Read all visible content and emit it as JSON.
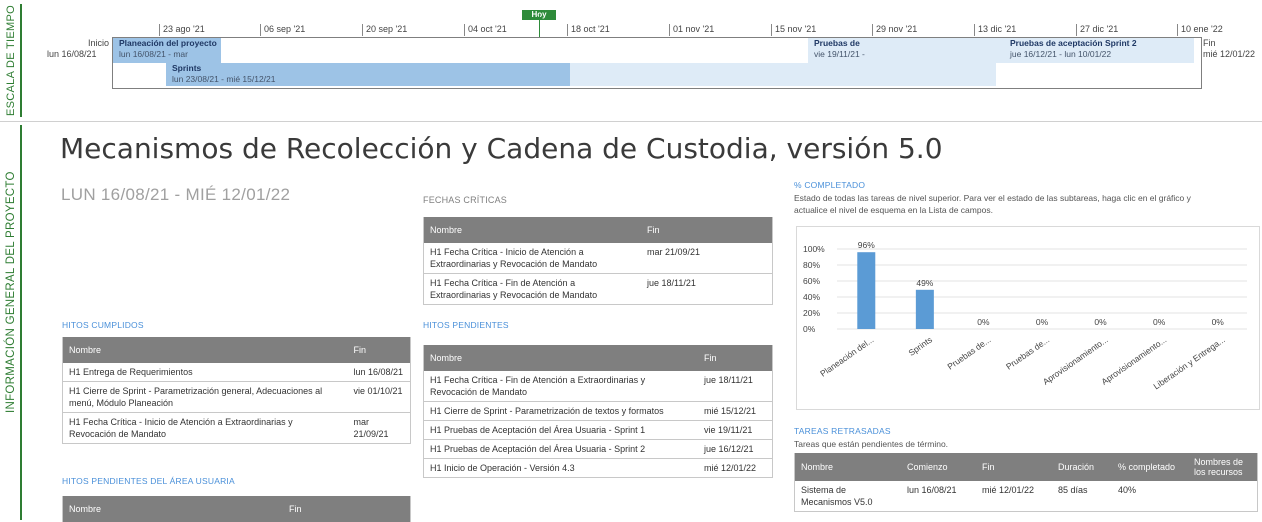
{
  "sidebar": {
    "timeline_label": "ESCALA DE TIEMPO",
    "project_label": "INFORMACIÓN GENERAL DEL PROYECTO"
  },
  "timeline": {
    "today_label": "Hoy",
    "start_label": "Inicio",
    "start_date": "lun 16/08/21",
    "end_label": "Fin",
    "end_date": "mié 12/01/22",
    "ticks": [
      "23 ago '21",
      "06 sep '21",
      "20 sep '21",
      "04 oct '21",
      "18 oct '21",
      "01 nov '21",
      "15 nov '21",
      "29 nov '21",
      "13 dic '21",
      "27 dic '21",
      "10 ene '22"
    ],
    "tasks": [
      {
        "name": "Planeación del proyecto",
        "dates": "lun 16/08/21 - mar"
      },
      {
        "name": "Sprints",
        "dates": "lun 23/08/21 - mié 15/12/21"
      },
      {
        "name": "Pruebas de",
        "dates": "vie 19/11/21 -"
      },
      {
        "name": "Pruebas de aceptación Sprint  2",
        "dates": "jue 16/12/21 - lun 10/01/22"
      }
    ],
    "colors": {
      "bar_dark": "#9dc3e6",
      "bar_light": "#deebf7",
      "today": "#2e8b3a"
    }
  },
  "project": {
    "title": "Mecanismos de Recolección y Cadena de Custodia, versión 5.0",
    "date_range": "LUN 16/08/21 -  MIÉ 12/01/22"
  },
  "hitos_cumplidos": {
    "title": "HITOS CUMPLIDOS",
    "headers": [
      "Nombre",
      "Fin"
    ],
    "rows": [
      [
        "H1 Entrega de Requerimientos",
        "lun 16/08/21"
      ],
      [
        "H1 Cierre de Sprint - Parametrización general, Adecuaciones al menú, Módulo Planeación",
        "vie 01/10/21"
      ],
      [
        "H1 Fecha Crítica - Inicio de Atención a Extraordinarias y Revocación de Mandato",
        "mar 21/09/21"
      ]
    ]
  },
  "hitos_usuaria": {
    "title": "HITOS PENDIENTES DEL ÁREA USUARIA",
    "headers": [
      "Nombre",
      "Fin"
    ]
  },
  "fechas_criticas": {
    "title": "FECHAS CRÍTICAS",
    "headers": [
      "Nombre",
      "Fin"
    ],
    "rows": [
      [
        "H1 Fecha Crítica - Inicio de Atención a Extraordinarias y Revocación de Mandato",
        "mar 21/09/21"
      ],
      [
        "H1 Fecha Crítica - Fin de Atención a Extraordinarias y Revocación de Mandato",
        "jue 18/11/21"
      ]
    ]
  },
  "hitos_pendientes": {
    "title": "HITOS PENDIENTES",
    "headers": [
      "Nombre",
      "Fin"
    ],
    "rows": [
      [
        "H1 Fecha Crítica - Fin de Atención a Extraordinarias y Revocación de Mandato",
        "jue 18/11/21"
      ],
      [
        "H1 Cierre de Sprint - Parametrización de textos y formatos",
        "mié 15/12/21"
      ],
      [
        "H1 Pruebas de Aceptación del Área Usuaria - Sprint 1",
        "vie 19/11/21"
      ],
      [
        "H1 Pruebas de Aceptación del Área Usuaria - Sprint 2",
        "jue 16/12/21"
      ],
      [
        "H1 Inicio de Operación - Versión 4.3",
        "mié 12/01/22"
      ]
    ]
  },
  "completado": {
    "title": "% COMPLETADO",
    "description": "Estado de todas las tareas de nivel superior. Para ver el estado de las subtareas, haga clic en el gráfico y actualice el nivel de esquema en la Lista de campos."
  },
  "chart_data": {
    "type": "bar",
    "categories": [
      "Planeación del...",
      "Sprints",
      "Pruebas de...",
      "Pruebas de...",
      "Aprovisionamiento...",
      "Aprovisionamiento...",
      "Liberación y Entrega..."
    ],
    "values": [
      96,
      49,
      0,
      0,
      0,
      0,
      0
    ],
    "value_labels": [
      "96%",
      "49%",
      "0%",
      "0%",
      "0%",
      "0%",
      "0%"
    ],
    "yticks": [
      "100%",
      "80%",
      "60%",
      "40%",
      "20%",
      "0%"
    ],
    "ylim": [
      0,
      100
    ],
    "grid": true,
    "color": "#5b9bd5"
  },
  "tareas_retrasadas": {
    "title": "TAREAS RETRASADAS",
    "description": "Tareas que están pendientes de término.",
    "headers": [
      "Nombre",
      "Comienzo",
      "Fin",
      "Duración",
      "% completado",
      "Nombres de los recursos"
    ],
    "rows": [
      [
        "Sistema de Mecanismos V5.0",
        "lun 16/08/21",
        "mié 12/01/22",
        "85 días",
        "40%",
        ""
      ]
    ]
  }
}
